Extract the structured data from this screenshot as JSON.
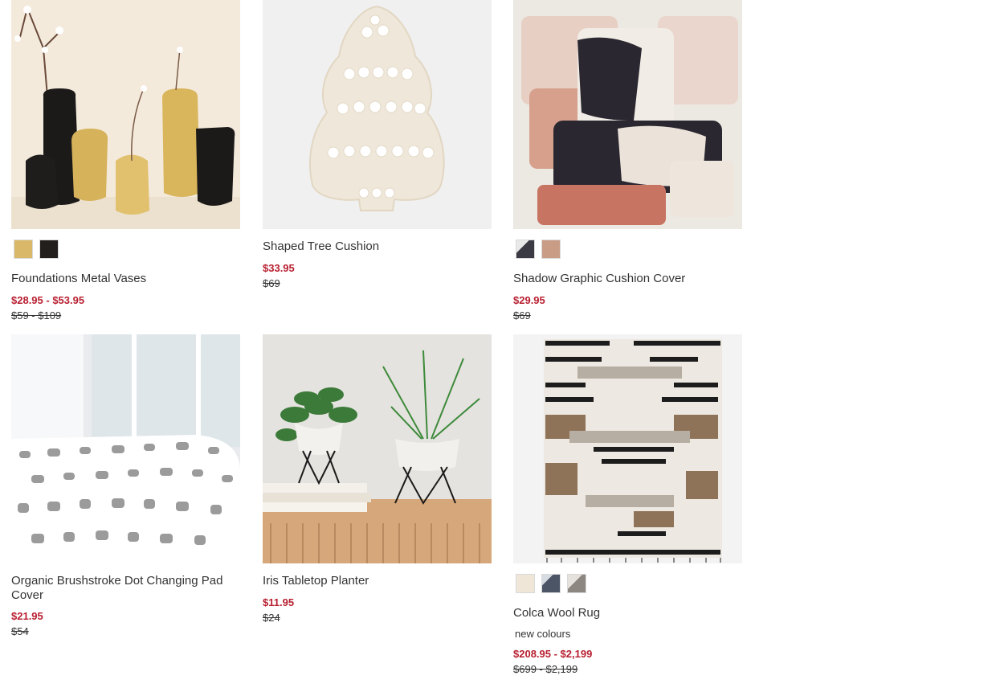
{
  "accent": {
    "sale_color": "#b81f30",
    "text_color": "#333333"
  },
  "products": [
    {
      "name": "Foundations Metal Vases",
      "sale_price": "$28.95 - $53.95",
      "original_price": "$59 - $109",
      "swatches": [
        {
          "color": "#d9b86a"
        },
        {
          "color": "#231f1d"
        }
      ]
    },
    {
      "name": "Shaped Tree Cushion",
      "sale_price": "$33.95",
      "original_price": "$69",
      "swatches": []
    },
    {
      "name": "Shadow Graphic Cushion Cover",
      "sale_price": "$29.95",
      "original_price": "$69",
      "swatches": [
        {
          "color": "#4a4a55"
        },
        {
          "color": "#c99c86"
        }
      ]
    },
    {
      "name": "Organic Brushstroke Dot Changing Pad Cover",
      "sale_price": "$21.95",
      "original_price": "$54",
      "swatches": []
    },
    {
      "name": "Iris Tabletop Planter",
      "sale_price": "$11.95",
      "original_price": "$24",
      "swatches": []
    },
    {
      "name": "Colca Wool Rug",
      "note": "new colours",
      "sale_price": "$208.95 - $2,199",
      "original_price": "$699 - $2,199",
      "swatches": [
        {
          "color": "#efe6d8"
        },
        {
          "color": "#4c5566"
        },
        {
          "color": "#b0aaa4"
        }
      ]
    }
  ]
}
